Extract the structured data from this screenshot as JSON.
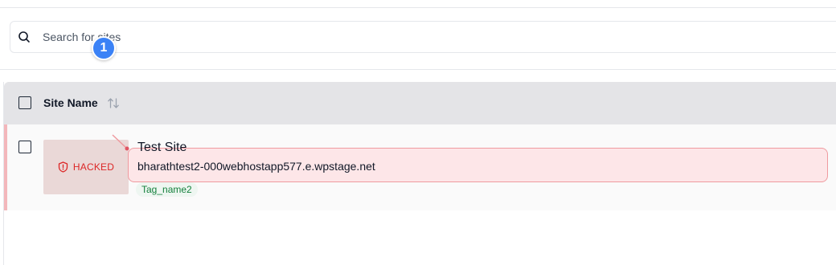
{
  "search": {
    "placeholder": "Search for sites",
    "value": ""
  },
  "table": {
    "header": {
      "site_name_label": "Site Name"
    },
    "rows": [
      {
        "status": "HACKED",
        "title": "Test Site",
        "url": "bharathtest2-000webhostapp577.e.wpstage.net",
        "tag": "Tag_name2"
      }
    ]
  },
  "annotation": {
    "step": "1"
  },
  "colors": {
    "hacked": "#dc2626",
    "highlight_border": "#ef9a9f",
    "badge": "#3b82f6",
    "tag_text": "#15803d"
  }
}
